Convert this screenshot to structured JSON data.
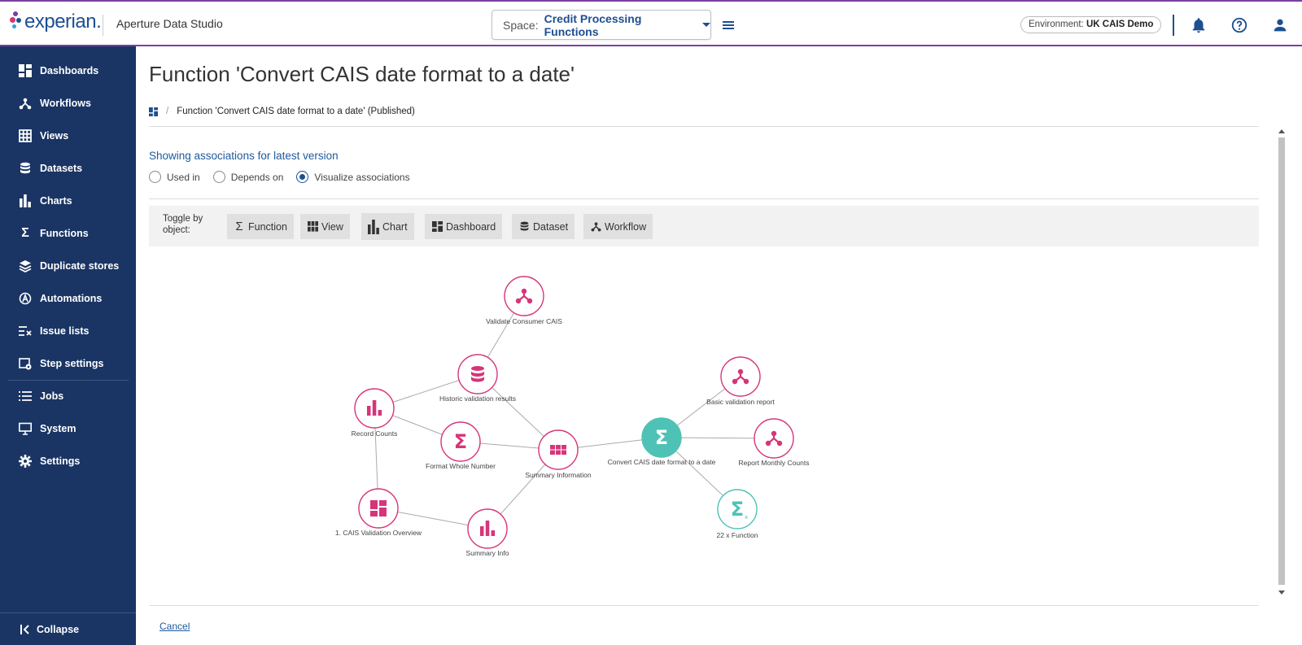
{
  "header": {
    "logo_text": "experian.",
    "app_name": "Aperture Data Studio",
    "space_label": "Space:",
    "space_value": "Credit Processing Functions",
    "environment_label": "Environment:",
    "environment_value": "UK CAIS Demo",
    "icons": [
      "menu-icon",
      "bell-icon",
      "help-icon",
      "user-icon"
    ]
  },
  "sidebar": {
    "items": [
      {
        "label": "Dashboards",
        "icon": "dashboard-icon"
      },
      {
        "label": "Workflows",
        "icon": "workflow-icon"
      },
      {
        "label": "Views",
        "icon": "grid-icon"
      },
      {
        "label": "Datasets",
        "icon": "database-icon"
      },
      {
        "label": "Charts",
        "icon": "bar-chart-icon"
      },
      {
        "label": "Functions",
        "icon": "sigma-icon"
      },
      {
        "label": "Duplicate stores",
        "icon": "layers-icon"
      },
      {
        "label": "Automations",
        "icon": "automation-icon"
      },
      {
        "label": "Issue lists",
        "icon": "issue-list-icon"
      },
      {
        "label": "Step settings",
        "icon": "step-settings-icon"
      },
      {
        "label": "Jobs",
        "icon": "list-icon"
      },
      {
        "label": "System",
        "icon": "monitor-icon"
      },
      {
        "label": "Settings",
        "icon": "gear-icon"
      }
    ],
    "collapse_label": "Collapse"
  },
  "main": {
    "title": "Function 'Convert CAIS date format to a date'",
    "breadcrumb": "Function 'Convert CAIS date format to a date' (Published)",
    "assoc_heading": "Showing associations for latest version",
    "radios": [
      {
        "label": "Used in",
        "checked": false
      },
      {
        "label": "Depends on",
        "checked": false
      },
      {
        "label": "Visualize associations",
        "checked": true
      }
    ],
    "toggle_label": "Toggle by object:",
    "toggle_buttons": [
      {
        "label": "Function",
        "icon": "sigma-icon"
      },
      {
        "label": "View",
        "icon": "grid-icon"
      },
      {
        "label": "Chart",
        "icon": "bar-chart-icon"
      },
      {
        "label": "Dashboard",
        "icon": "dashboard-icon"
      },
      {
        "label": "Dataset",
        "icon": "database-icon"
      },
      {
        "label": "Workflow",
        "icon": "workflow-icon"
      }
    ],
    "cancel_label": "Cancel"
  },
  "graph": {
    "colors": {
      "object": "#d6357a",
      "selected": "#4ec2b5",
      "edge": "#aaaaaa"
    },
    "nodes": [
      {
        "id": "n1",
        "label": "Validate Consumer CAIS",
        "type": "workflow"
      },
      {
        "id": "n2",
        "label": "Historic validation results",
        "type": "dataset"
      },
      {
        "id": "n3",
        "label": "Basic validation report",
        "type": "workflow"
      },
      {
        "id": "n4",
        "label": "Record Counts",
        "type": "chart"
      },
      {
        "id": "n5",
        "label": "Format Whole Number",
        "type": "function"
      },
      {
        "id": "n6",
        "label": "Summary Information",
        "type": "view"
      },
      {
        "id": "n7",
        "label": "Convert CAIS date format to a date",
        "type": "selected"
      },
      {
        "id": "n8",
        "label": "Report Monthly Counts",
        "type": "workflow"
      },
      {
        "id": "n9",
        "label": "22 x Function",
        "type": "function-group"
      },
      {
        "id": "n10",
        "label": "1. CAIS Validation Overview",
        "type": "dashboard"
      },
      {
        "id": "n11",
        "label": "Summary Info",
        "type": "chart"
      }
    ],
    "edges": [
      [
        "n1",
        "n2"
      ],
      [
        "n2",
        "n4"
      ],
      [
        "n2",
        "n6"
      ],
      [
        "n4",
        "n5"
      ],
      [
        "n5",
        "n6"
      ],
      [
        "n4",
        "n10"
      ],
      [
        "n10",
        "n11"
      ],
      [
        "n11",
        "n6"
      ],
      [
        "n6",
        "n7"
      ],
      [
        "n7",
        "n3"
      ],
      [
        "n7",
        "n8"
      ],
      [
        "n7",
        "n9"
      ]
    ]
  }
}
